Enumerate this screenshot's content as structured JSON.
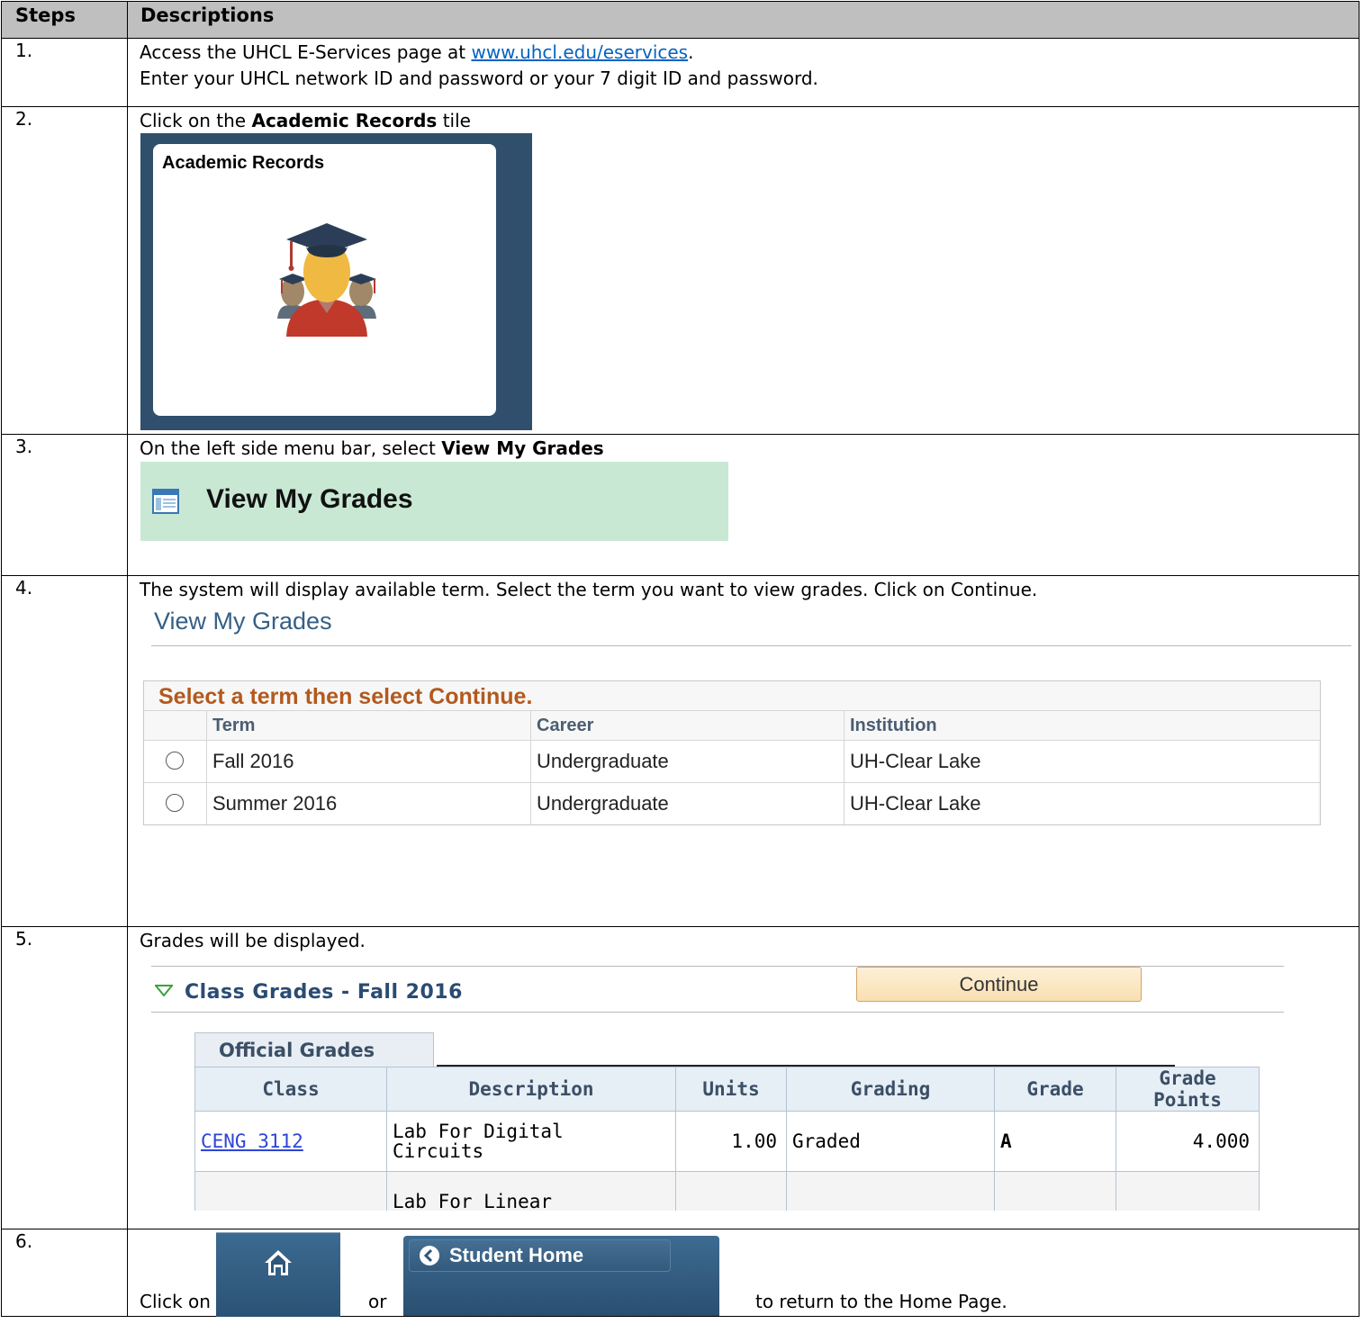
{
  "headers": {
    "steps": "Steps",
    "descriptions": "Descriptions"
  },
  "step1": {
    "num": "1.",
    "line1_prefix": "Access the UHCL E-Services page at ",
    "link": "www.uhcl.edu/eservices",
    "line1_suffix": ".",
    "line2": "Enter your UHCL network ID and password or your 7 digit ID and password."
  },
  "step2": {
    "num": "2.",
    "prefix": "Click on the ",
    "bold": "Academic Records",
    "suffix": " tile",
    "tile_title": "Academic Records",
    "tile_icon": "graduates-icon"
  },
  "step3": {
    "num": "3.",
    "prefix": "On the left side menu bar, select ",
    "bold": "View My Grades",
    "menu_label": "View My Grades",
    "menu_icon": "page-window-icon"
  },
  "step4": {
    "num": "4.",
    "text": "The system will display available term. Select the term you want to view grades. Click on Continue.",
    "page_title": "View My Grades",
    "grid_title": "Select a term then select Continue.",
    "columns": [
      "Term",
      "Career",
      "Institution"
    ],
    "rows": [
      {
        "term": "Fall 2016",
        "career": "Undergraduate",
        "institution": "UH-Clear Lake"
      },
      {
        "term": "Summer 2016",
        "career": "Undergraduate",
        "institution": "UH-Clear Lake"
      }
    ],
    "continue_label": "Continue"
  },
  "step5": {
    "num": "5.",
    "text": "Grades will be displayed.",
    "section_title": "Class Grades - Fall 2016",
    "tab_label": "Official Grades",
    "columns": {
      "class": "Class",
      "description": "Description",
      "units": "Units",
      "grading": "Grading",
      "grade": "Grade",
      "grade_points_1": "Grade",
      "grade_points_2": "Points"
    },
    "row1": {
      "class": "CENG 3112",
      "description_1": "Lab For Digital",
      "description_2": "Circuits",
      "units": "1.00",
      "grading": "Graded",
      "grade": "A",
      "grade_points": "4.000"
    },
    "row2_partial": {
      "description_1": "Lab For Linear"
    }
  },
  "step6": {
    "num": "6.",
    "click_on": "Click on",
    "or": "or",
    "suffix": "to return to the Home Page.",
    "home_icon": "home-icon",
    "student_home_label": "Student Home",
    "back_icon": "chevron-left-icon"
  },
  "colors": {
    "header_bg": "#bfbfbf",
    "tile_bg": "#2f4f6c",
    "menu_bg": "#c9e8d4",
    "link": "#0563c1",
    "grid_title": "#b3591d",
    "button_blue": "#2b5274"
  }
}
